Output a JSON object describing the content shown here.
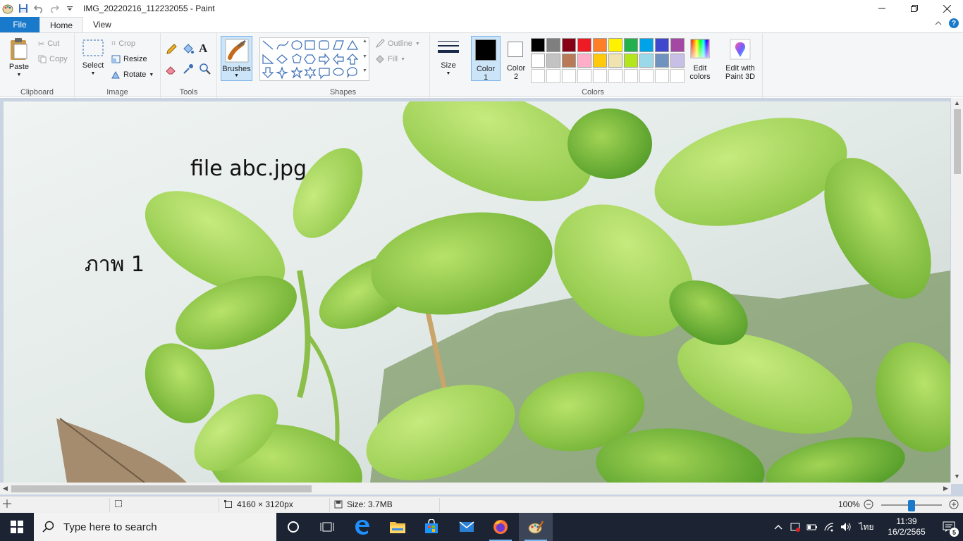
{
  "window": {
    "title": "IMG_20220216_112232055 - Paint"
  },
  "ribbon_tabs": [
    "File",
    "Home",
    "View"
  ],
  "clipboard": {
    "paste": "Paste",
    "cut": "Cut",
    "copy": "Copy",
    "label": "Clipboard"
  },
  "image": {
    "select": "Select",
    "crop": "Crop",
    "resize": "Resize",
    "rotate": "Rotate",
    "label": "Image"
  },
  "tools": {
    "label": "Tools"
  },
  "brushes": {
    "label": "Brushes"
  },
  "shapes": {
    "outline": "Outline",
    "fill": "Fill",
    "label": "Shapes"
  },
  "size": {
    "label": "Size"
  },
  "colors": {
    "color1_label": "Color",
    "color1_num": "1",
    "color2_label": "Color",
    "color2_num": "2",
    "edit_colors_line1": "Edit",
    "edit_colors_line2": "colors",
    "label": "Colors",
    "color1": "#000000",
    "color2": "#ffffff",
    "palette_row1": [
      "#000000",
      "#7f7f7f",
      "#880015",
      "#ed1c24",
      "#ff7f27",
      "#fff200",
      "#22b14c",
      "#00a2e8",
      "#3f48cc",
      "#a349a4"
    ],
    "palette_row2": [
      "#ffffff",
      "#c3c3c3",
      "#b97a57",
      "#ffaec9",
      "#ffc90e",
      "#efe4b0",
      "#b5e61d",
      "#99d9ea",
      "#7092be",
      "#c8bfe7"
    ]
  },
  "paint3d": {
    "line1": "Edit with",
    "line2": "Paint 3D"
  },
  "canvas": {
    "text1": "file  abc.jpg",
    "text2": "ภาพ 1"
  },
  "status": {
    "dimensions": "4160 × 3120px",
    "size": "Size: 3.7MB",
    "zoom": "100%",
    "zoom_fraction": 0.5
  },
  "taskbar": {
    "search_placeholder": "Type here to search",
    "language": "ไทย",
    "time": "11:39",
    "date": "16/2/2565",
    "notifications": "5"
  }
}
